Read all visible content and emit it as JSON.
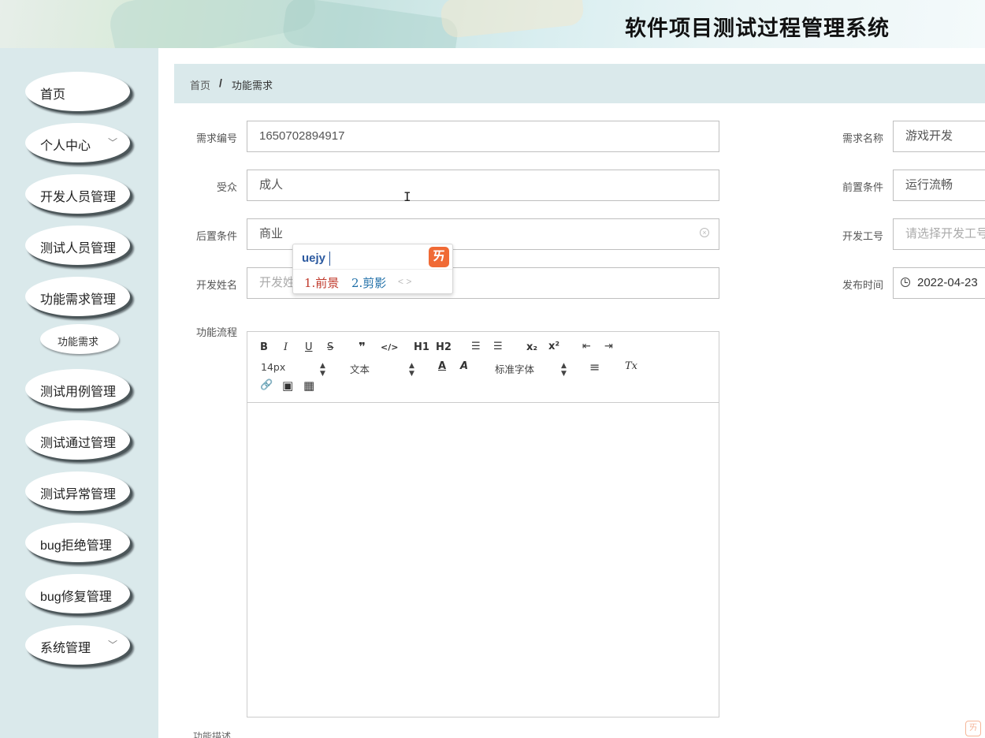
{
  "header": {
    "title": "软件项目测试过程管理系统"
  },
  "sidebar": {
    "items": [
      {
        "label": "首页",
        "chevron": ""
      },
      {
        "label": "个人中心",
        "chevron": "﹀"
      },
      {
        "label": "开发人员管理",
        "chevron": ""
      },
      {
        "label": "测试人员管理",
        "chevron": ""
      },
      {
        "label": "功能需求管理",
        "chevron": ""
      },
      {
        "label": "测试用例管理",
        "chevron": ""
      },
      {
        "label": "测试通过管理",
        "chevron": ""
      },
      {
        "label": "测试异常管理",
        "chevron": ""
      },
      {
        "label": "bug拒绝管理",
        "chevron": ""
      },
      {
        "label": "bug修复管理",
        "chevron": ""
      },
      {
        "label": "系统管理",
        "chevron": "﹀"
      }
    ],
    "sub_item": "功能需求"
  },
  "breadcrumb": {
    "home": "首页",
    "separator": "/",
    "current": "功能需求"
  },
  "form": {
    "req_id": {
      "label": "需求编号",
      "value": "1650702894917"
    },
    "req_name": {
      "label": "需求名称",
      "value": "游戏开发"
    },
    "audience": {
      "label": "受众",
      "value": "成人"
    },
    "precondition": {
      "label": "前置条件",
      "value": "运行流畅"
    },
    "postcondition": {
      "label": "后置条件",
      "value": "商业"
    },
    "dev_id": {
      "label": "开发工号",
      "placeholder": "请选择开发工号"
    },
    "dev_name": {
      "label": "开发姓名",
      "placeholder": "开发姓名"
    },
    "publish_time": {
      "label": "发布时间",
      "value": "2022-04-23"
    },
    "flow": {
      "label": "功能流程"
    }
  },
  "editor": {
    "bold": "B",
    "italic": "I",
    "underline": "U",
    "strike": "S",
    "quote": "❞",
    "code": "</>",
    "h1": "H1",
    "h2": "H2",
    "ol": "☰",
    "ul": "☰",
    "sub": "x₂",
    "sup": "x²",
    "outdent": "⇤",
    "indent": "⇥",
    "size": "14px",
    "text_type": "文本",
    "color": "A",
    "bg_color": "A",
    "font": "标准字体",
    "align": "≡",
    "clear": "Tx",
    "link": "🔗",
    "image": "▣",
    "video": "▦"
  },
  "ime": {
    "typed": "uejy",
    "cand1": "1.前景",
    "cand2": "2.剪影",
    "nav": "< >",
    "logo": "ㄞ"
  },
  "cursor": "I",
  "corner_logo": "ㄞ",
  "bottom_cut_label": "功能描述"
}
